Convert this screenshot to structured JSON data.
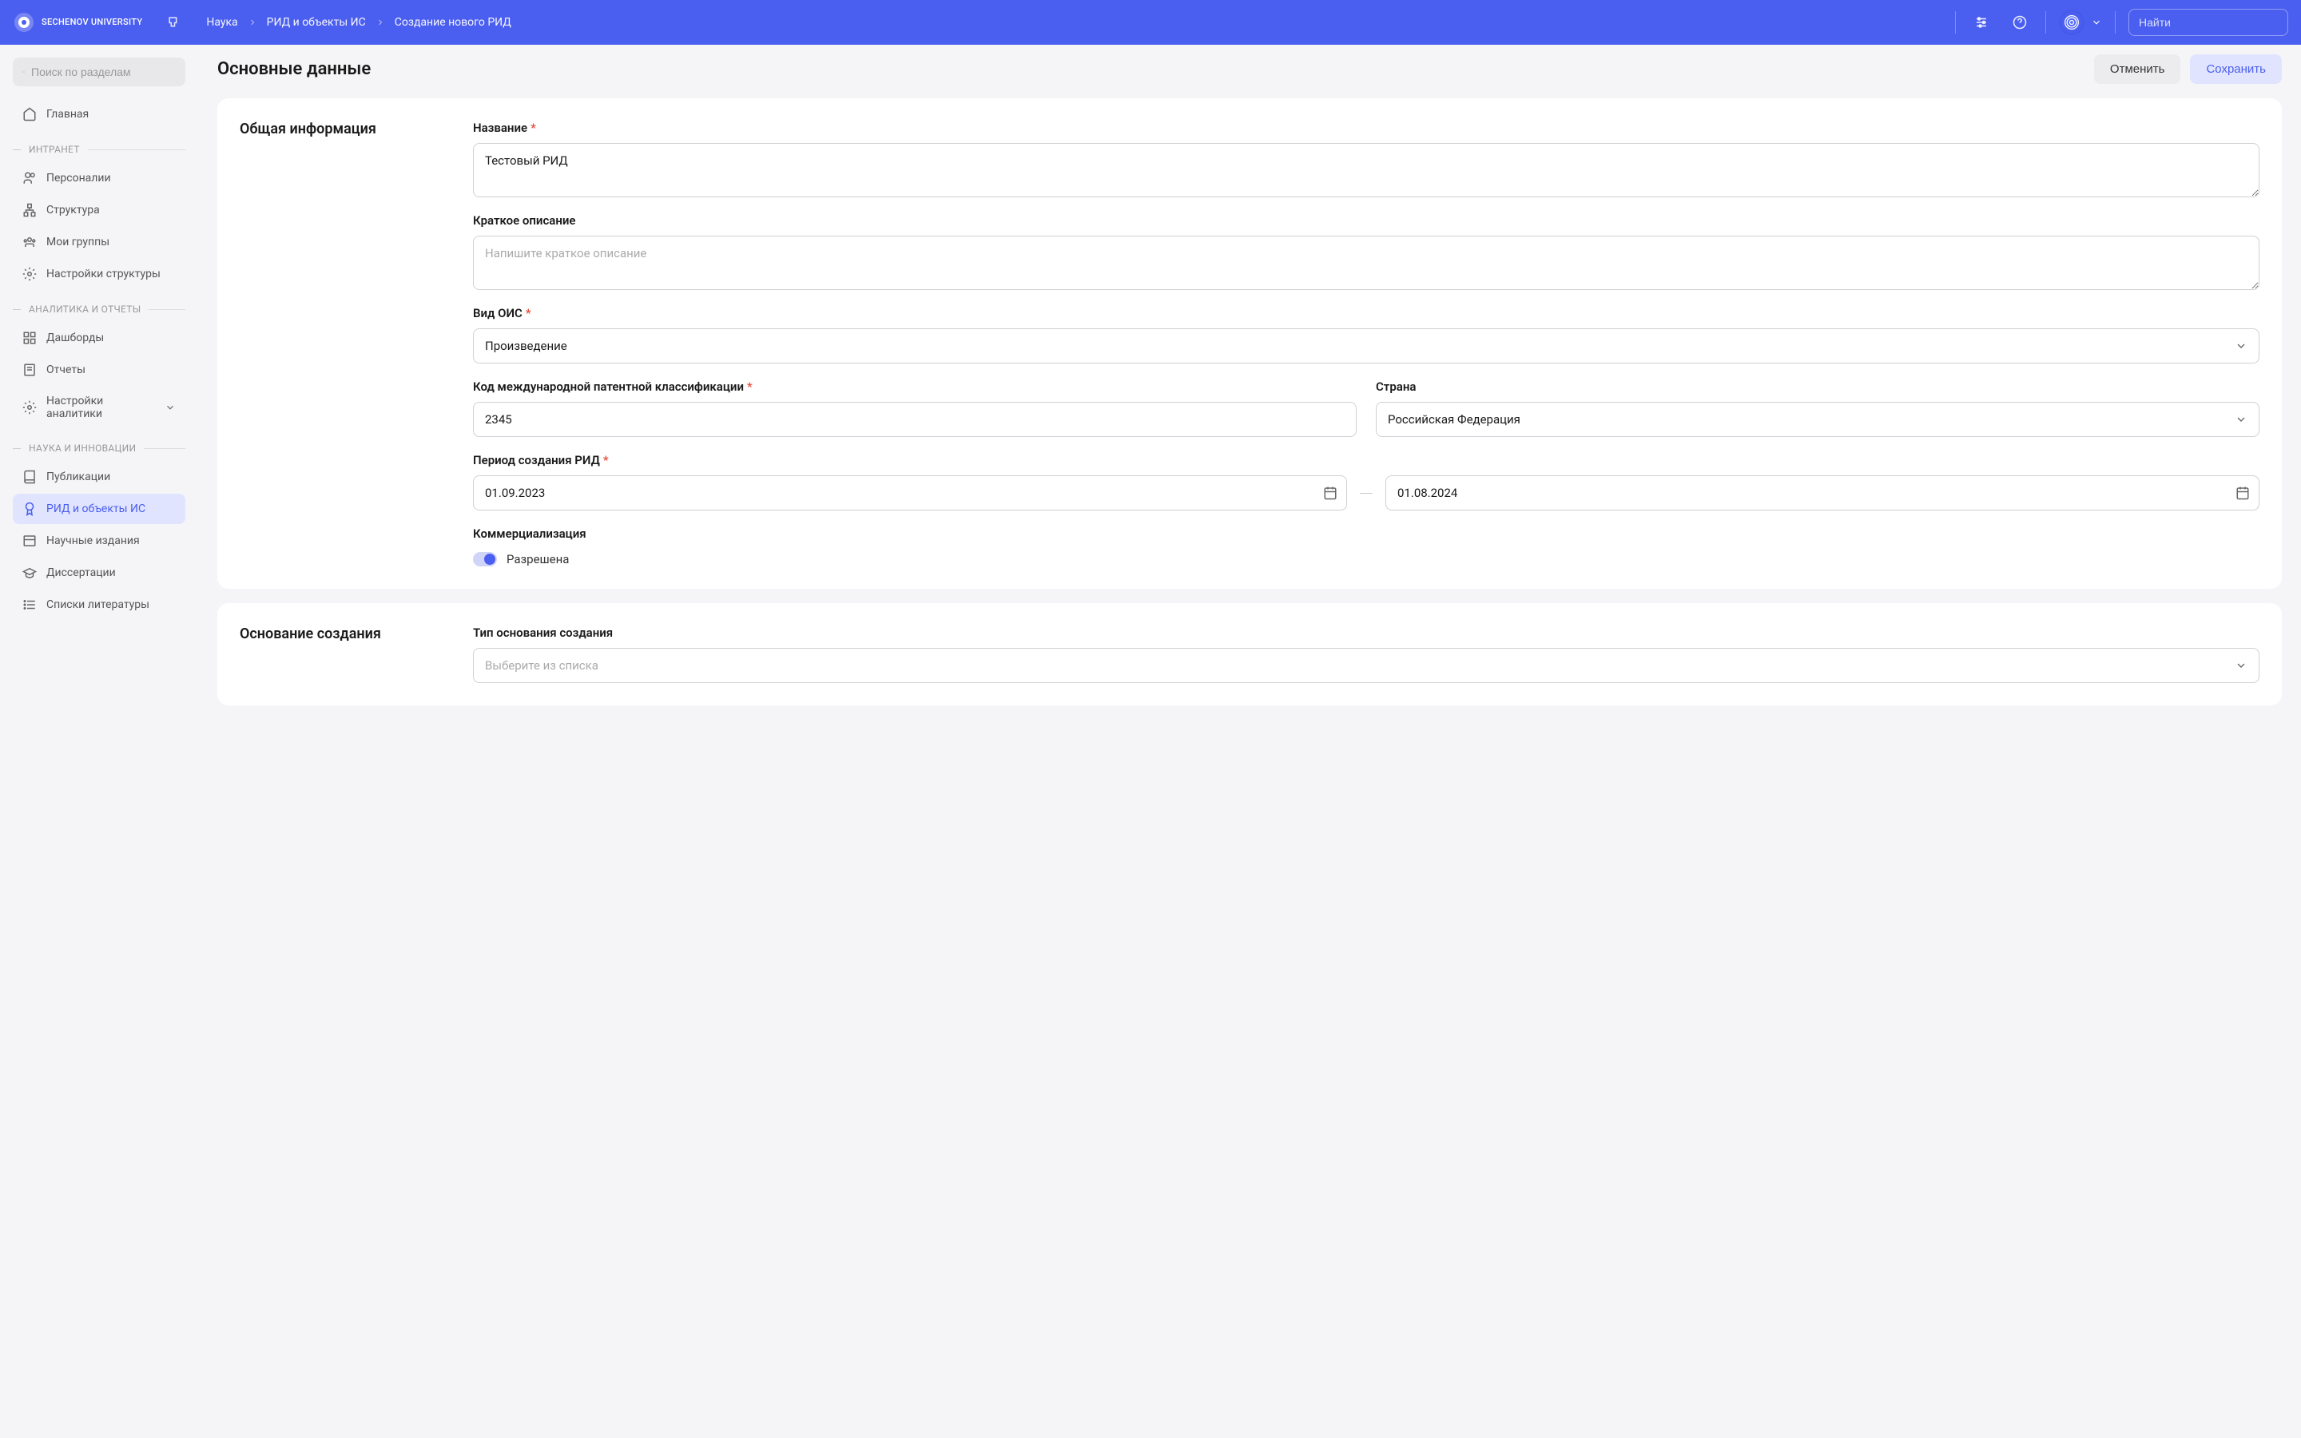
{
  "header": {
    "logo_text": "SECHENOV\nUNIVERSITY",
    "search_placeholder": "Найти"
  },
  "breadcrumb": [
    "Наука",
    "РИД и объекты ИС",
    "Создание нового РИД"
  ],
  "sidebar": {
    "search_placeholder": "Поиск по разделам",
    "sections": [
      {
        "title": null,
        "items": [
          {
            "label": "Главная",
            "icon": "home"
          }
        ]
      },
      {
        "title": "ИНТРАНЕТ",
        "items": [
          {
            "label": "Персоналии",
            "icon": "users"
          },
          {
            "label": "Структура",
            "icon": "sitemap"
          },
          {
            "label": "Мои группы",
            "icon": "group"
          },
          {
            "label": "Настройки структуры",
            "icon": "gear"
          }
        ]
      },
      {
        "title": "АНАЛИТИКА И ОТЧЕТЫ",
        "items": [
          {
            "label": "Дашборды",
            "icon": "dashboard"
          },
          {
            "label": "Отчеты",
            "icon": "report"
          },
          {
            "label": "Настройки аналитики",
            "icon": "gear",
            "expandable": true
          }
        ]
      },
      {
        "title": "НАУКА И ИННОВАЦИИ",
        "items": [
          {
            "label": "Публикации",
            "icon": "book"
          },
          {
            "label": "РИД и объекты ИС",
            "icon": "award",
            "active": true
          },
          {
            "label": "Научные издания",
            "icon": "publications"
          },
          {
            "label": "Диссертации",
            "icon": "graduation"
          },
          {
            "label": "Списки литературы",
            "icon": "list"
          }
        ]
      }
    ]
  },
  "page": {
    "title": "Основные данные",
    "cancel": "Отменить",
    "save": "Сохранить"
  },
  "form": {
    "section1_title": "Общая информация",
    "name_label": "Название",
    "name_value": "Тестовый РИД",
    "desc_label": "Краткое описание",
    "desc_placeholder": "Напишите краткое описание",
    "type_label": "Вид ОИС",
    "type_value": "Произведение",
    "code_label": "Код международной патентной классификации",
    "code_value": "2345",
    "country_label": "Страна",
    "country_value": "Российская Федерация",
    "period_label": "Период создания РИД",
    "date_from": "01.09.2023",
    "date_to": "01.08.2024",
    "commerce_label": "Коммерциализация",
    "commerce_toggle": "Разрешена",
    "section2_title": "Основание создания",
    "basis_label": "Тип основания создания",
    "basis_placeholder": "Выберите из списка"
  }
}
